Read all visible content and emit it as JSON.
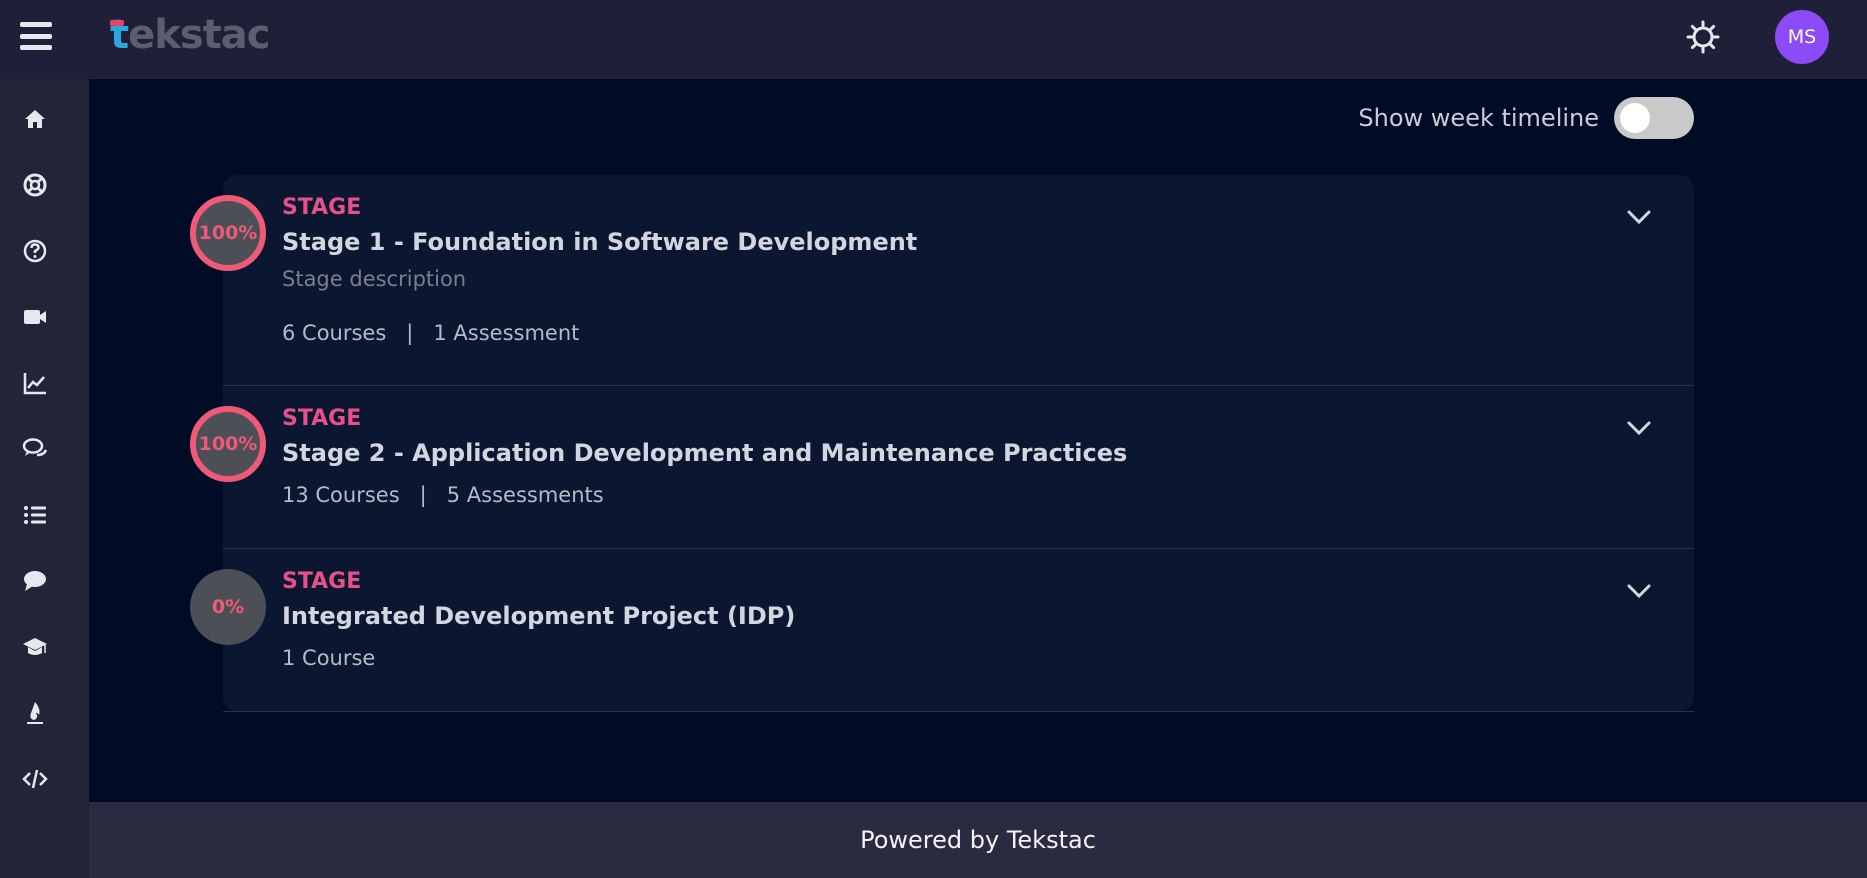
{
  "header": {
    "logo_first": "t",
    "logo_rest": "ekstac",
    "avatar_initials": "MS"
  },
  "sidebar": {
    "items": [
      {
        "icon": "home-icon"
      },
      {
        "icon": "lifebuoy-icon"
      },
      {
        "icon": "help-icon"
      },
      {
        "icon": "video-icon"
      },
      {
        "icon": "chart-line-icon"
      },
      {
        "icon": "chat-bubbles-icon"
      },
      {
        "icon": "list-icon"
      },
      {
        "icon": "comment-icon"
      },
      {
        "icon": "graduation-cap-icon"
      },
      {
        "icon": "fire-icon"
      },
      {
        "icon": "code-icon"
      }
    ]
  },
  "timeline": {
    "label": "Show week timeline",
    "enabled": false
  },
  "stages": [
    {
      "progress_label": "100%",
      "progress": 100,
      "tag": "STAGE",
      "title": "Stage 1 - Foundation in Software Development",
      "description": "Stage description",
      "courses": "6 Courses",
      "separator": "|",
      "assessments": "1 Assessment"
    },
    {
      "progress_label": "100%",
      "progress": 100,
      "tag": "STAGE",
      "title": "Stage 2 - Application Development and Maintenance Practices",
      "courses": "13 Courses",
      "separator": "|",
      "assessments": "5 Assessments"
    },
    {
      "progress_label": "0%",
      "progress": 0,
      "tag": "STAGE",
      "title": "Integrated Development Project (IDP)",
      "courses": "1 Course"
    }
  ],
  "footer": {
    "text": "Powered by Tekstac"
  },
  "colors": {
    "accent_pink": "#e7508a",
    "progress_ring": "#ee5a78",
    "avatar": "#8b4cf7",
    "background": "#000c26",
    "card": "#0b1730"
  }
}
